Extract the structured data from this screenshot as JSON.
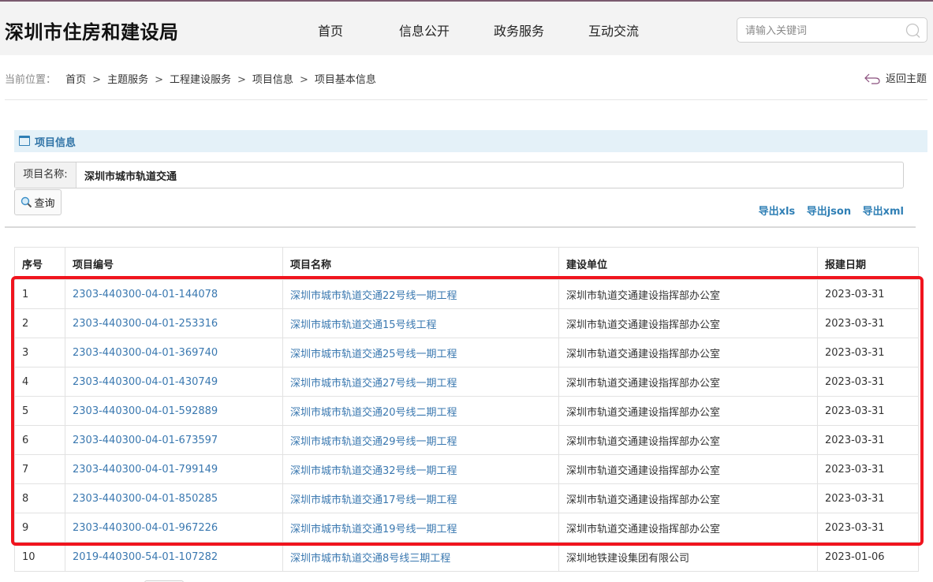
{
  "header": {
    "site_title": "深圳市住房和建设局",
    "nav": [
      "首页",
      "信息公开",
      "政务服务",
      "互动交流"
    ],
    "search_placeholder": "请输入关键词"
  },
  "breadcrumb": {
    "prefix": "当前位置：",
    "items": [
      "首页",
      "主题服务",
      "工程建设服务",
      "项目信息",
      "项目基本信息"
    ],
    "separator": ">",
    "back_label": "返回主题"
  },
  "section": {
    "title": "项目信息"
  },
  "query": {
    "label": "项目名称:",
    "value": "深圳市城市轨道交通",
    "button": "查询"
  },
  "exports": [
    "导出xls",
    "导出json",
    "导出xml"
  ],
  "table": {
    "headers": [
      "序号",
      "项目编号",
      "项目名称",
      "建设单位",
      "报建日期"
    ],
    "rows": [
      [
        "1",
        "2303-440300-04-01-144078",
        "深圳市城市轨道交通22号线一期工程",
        "深圳市轨道交通建设指挥部办公室",
        "2023-03-31"
      ],
      [
        "2",
        "2303-440300-04-01-253316",
        "深圳市城市轨道交通15号线工程",
        "深圳市轨道交通建设指挥部办公室",
        "2023-03-31"
      ],
      [
        "3",
        "2303-440300-04-01-369740",
        "深圳市城市轨道交通25号线一期工程",
        "深圳市轨道交通建设指挥部办公室",
        "2023-03-31"
      ],
      [
        "4",
        "2303-440300-04-01-430749",
        "深圳市城市轨道交通27号线一期工程",
        "深圳市轨道交通建设指挥部办公室",
        "2023-03-31"
      ],
      [
        "5",
        "2303-440300-04-01-592889",
        "深圳市城市轨道交通20号线二期工程",
        "深圳市轨道交通建设指挥部办公室",
        "2023-03-31"
      ],
      [
        "6",
        "2303-440300-04-01-673597",
        "深圳市城市轨道交通29号线一期工程",
        "深圳市轨道交通建设指挥部办公室",
        "2023-03-31"
      ],
      [
        "7",
        "2303-440300-04-01-799149",
        "深圳市城市轨道交通32号线一期工程",
        "深圳市轨道交通建设指挥部办公室",
        "2023-03-31"
      ],
      [
        "8",
        "2303-440300-04-01-850285",
        "深圳市城市轨道交通17号线一期工程",
        "深圳市轨道交通建设指挥部办公室",
        "2023-03-31"
      ],
      [
        "9",
        "2303-440300-04-01-967226",
        "深圳市城市轨道交通19号线一期工程",
        "深圳市轨道交通建设指挥部办公室",
        "2023-03-31"
      ],
      [
        "10",
        "2019-440300-54-01-107282",
        "深圳市城市轨道交通8号线三期工程",
        "深圳地铁建设集团有限公司",
        "2023-01-06"
      ]
    ]
  },
  "colors": {
    "link": "#3a78b0",
    "highlight": "#f0141e",
    "section_bg": "#e4f1f8",
    "header_bg": "#f3f3f3"
  },
  "icons": [
    "search-icon",
    "back-arrow-icon",
    "window-icon",
    "magnifier-icon"
  ]
}
